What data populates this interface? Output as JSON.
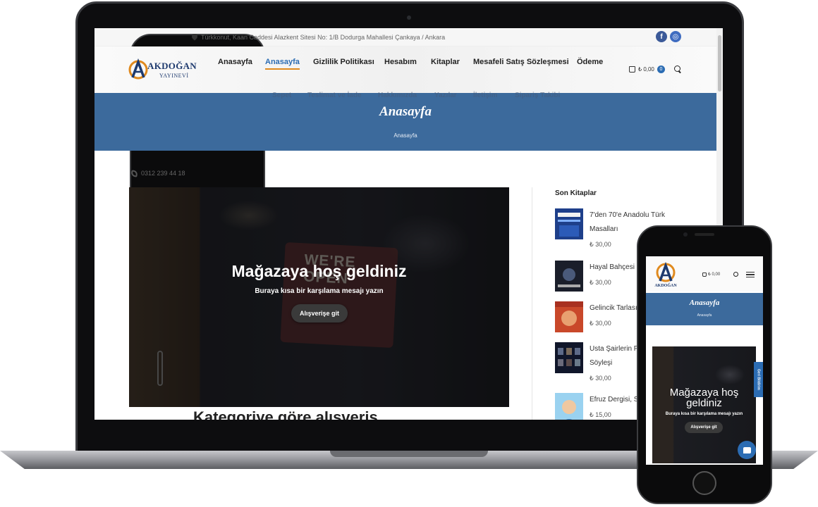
{
  "topbar": {
    "phone": "0312 239 44 18",
    "address": "Türkkonut, Kaan Caddesi Alazkent Sitesi No: 1/B Dodurga Mahallesi Çankaya / Ankara",
    "facebook_glyph": "f",
    "instagram_glyph": "◎"
  },
  "brand": {
    "logo_mark": "A",
    "name": "AKDOĞAN",
    "subtitle": "YAYINEVİ"
  },
  "nav": {
    "items": [
      "Anasayfa",
      "Anasayfa",
      "Gizlilik Politikası",
      "Hesabım",
      "Kitaplar",
      "Mesafeli Satış Sözleşmesi",
      "Ödeme"
    ],
    "active_index": 1,
    "row2": [
      "Sepet",
      "Teslimat ve İade",
      "Hakkımızda",
      "Yazılar",
      "İletişim",
      "Sipariş Takibi"
    ]
  },
  "cart": {
    "amount": "₺ 0,00",
    "count": "0"
  },
  "page": {
    "title": "Anasayfa",
    "breadcrumb": "Anasayfa"
  },
  "hero": {
    "title": "Mağazaya hoş geldiniz",
    "subtitle": "Buraya kısa bir karşılama mesajı yazın",
    "button": "Alışverişe git",
    "sign_text": "WE'RE OPEN"
  },
  "section": {
    "heading": "Kategoriye göre alışveriş"
  },
  "sidebar": {
    "title": "Son Kitaplar",
    "books": [
      {
        "name": "7'den 70'e Anadolu Türk Masalları",
        "price": "₺ 30,00"
      },
      {
        "name": "Hayal Bahçesi",
        "price": "₺ 30,00"
      },
      {
        "name": "Gelincik Tarlası",
        "price": "₺ 30,00"
      },
      {
        "name": "Usta Şairlerin Piri Üzerine Söyleşi",
        "price": "₺ 30,00"
      },
      {
        "name": "Efruz Dergisi, Sayı",
        "price": "₺ 15,00"
      }
    ]
  },
  "mobile": {
    "cart_amount": "₺ 0,00",
    "page_title": "Anasayfa",
    "breadcrumb": "Anasayfa",
    "hero_title": "Mağazaya hoş geldiniz",
    "hero_subtitle": "Buraya kısa bir karşılama mesajı yazın",
    "hero_button": "Alışverişe git",
    "feedback_tab": "Geri Bildirim"
  },
  "colors": {
    "primary": "#3c6a9c",
    "accent": "#e08a1e",
    "link_active": "#2b6cb3"
  }
}
